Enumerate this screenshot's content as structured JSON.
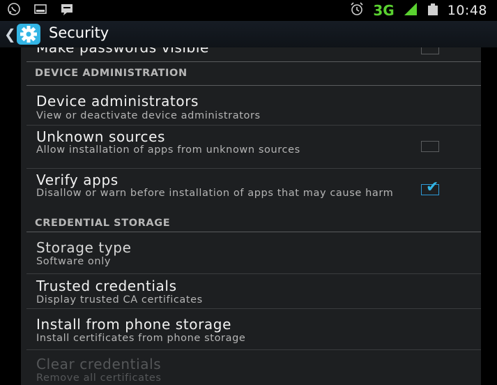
{
  "status_bar": {
    "time": "10:48",
    "network": "3G",
    "left_icons": [
      "whatsapp-icon",
      "screenshot-icon",
      "message-icon"
    ],
    "right_icons": [
      "alarm-icon",
      "signal-icon",
      "battery-icon"
    ]
  },
  "action_bar": {
    "title": "Security",
    "icon": "gear-icon",
    "accent": "#33b5e5"
  },
  "items": {
    "make_passwords_visible": {
      "title": "Make passwords visible",
      "checked": false
    },
    "device_admins": {
      "title": "Device administrators",
      "summary": "View or deactivate device administrators"
    },
    "unknown_sources": {
      "title": "Unknown sources",
      "summary": "Allow installation of apps from unknown sources",
      "checked": false
    },
    "verify_apps": {
      "title": "Verify apps",
      "summary": "Disallow or warn before installation of apps that may cause harm",
      "checked": true
    },
    "storage_type": {
      "title": "Storage type",
      "summary": "Software only"
    },
    "trusted_credentials": {
      "title": "Trusted credentials",
      "summary": "Display trusted CA certificates"
    },
    "install_from_storage": {
      "title": "Install from phone storage",
      "summary": "Install certificates from phone storage"
    },
    "clear_credentials": {
      "title": "Clear credentials",
      "summary": "Remove all certificates"
    }
  },
  "headers": {
    "device_admin": "DEVICE ADMINISTRATION",
    "credential_storage": "CREDENTIAL STORAGE"
  }
}
